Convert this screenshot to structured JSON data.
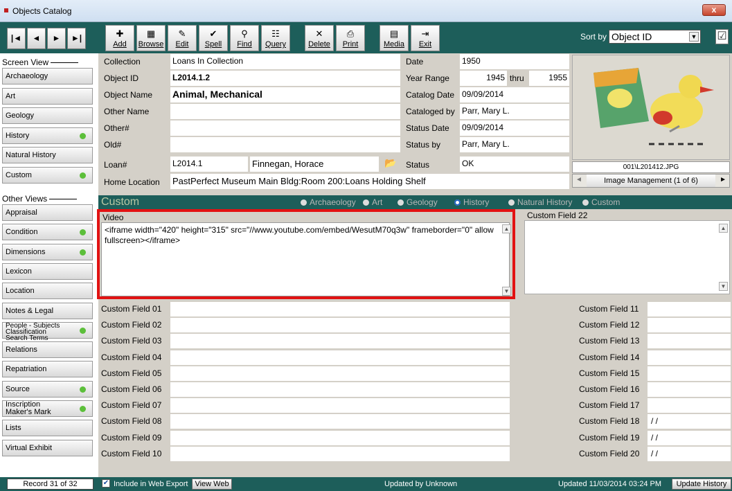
{
  "window": {
    "title": "Objects Catalog",
    "close_label": "x"
  },
  "toolbar": {
    "nav": [
      "|◄",
      "◄",
      "►",
      "►|"
    ],
    "buttons": [
      {
        "label": "Add",
        "glyph": "✚",
        "icon": "add-icon"
      },
      {
        "label": "Browse",
        "glyph": "▦",
        "icon": "browse-icon"
      },
      {
        "label": "Edit",
        "glyph": "✎",
        "icon": "edit-icon"
      },
      {
        "label": "Spell",
        "glyph": "✔",
        "icon": "spell-icon"
      },
      {
        "label": "Find",
        "glyph": "⚲",
        "icon": "find-icon"
      },
      {
        "label": "Query",
        "glyph": "☷",
        "icon": "query-icon"
      },
      {
        "label": "Delete",
        "glyph": "✕",
        "icon": "delete-icon"
      },
      {
        "label": "Print",
        "glyph": "⎙",
        "icon": "print-icon"
      },
      {
        "label": "Media",
        "glyph": "▤",
        "icon": "media-icon"
      },
      {
        "label": "Exit",
        "glyph": "⇥",
        "icon": "exit-icon"
      }
    ],
    "sort_label": "Sort by",
    "sort_value": "Object ID"
  },
  "sidebar": {
    "screen_view_label": "Screen View",
    "screen_views": [
      {
        "label": "Archaeology",
        "dot": false
      },
      {
        "label": "Art",
        "dot": false
      },
      {
        "label": "Geology",
        "dot": false
      },
      {
        "label": "History",
        "dot": true
      },
      {
        "label": "Natural History",
        "dot": false
      },
      {
        "label": "Custom",
        "dot": true
      }
    ],
    "other_views_label": "Other Views",
    "other_views": [
      {
        "label": "Appraisal",
        "dot": false
      },
      {
        "label": "Condition",
        "dot": true
      },
      {
        "label": "Dimensions",
        "dot": true
      },
      {
        "label": "Lexicon",
        "dot": false
      },
      {
        "label": "Location",
        "dot": false
      },
      {
        "label": "Notes & Legal",
        "dot": false
      },
      {
        "label": "People - Subjects\nClassification\nSearch Terms",
        "dot": true
      },
      {
        "label": "Relations",
        "dot": false
      },
      {
        "label": "Repatriation",
        "dot": false
      },
      {
        "label": "Source",
        "dot": true
      },
      {
        "label": "Inscription\nMaker's Mark",
        "dot": true
      },
      {
        "label": "Lists",
        "dot": false
      },
      {
        "label": "Virtual Exhibit",
        "dot": false
      }
    ]
  },
  "record": {
    "collection_label": "Collection",
    "collection": "Loans In Collection",
    "object_id_label": "Object ID",
    "object_id": "L2014.1.2",
    "object_name_label": "Object Name",
    "object_name": "Animal, Mechanical",
    "other_name_label": "Other Name",
    "other_name": "",
    "other_num_label": "Other#",
    "other_num": "",
    "old_num_label": "Old#",
    "old_num": "",
    "loan_label": "Loan#",
    "loan_num": "L2014.1",
    "loan_name": "Finnegan, Horace",
    "home_location_label": "Home Location",
    "home_location": "PastPerfect Museum Main Bldg:Room 200:Loans Holding Shelf",
    "date_label": "Date",
    "date": "1950",
    "year_range_label": "Year Range",
    "year_from": "1945",
    "thru_label": "thru",
    "year_to": "1955",
    "catalog_date_label": "Catalog Date",
    "catalog_date": "09/09/2014",
    "cataloged_by_label": "Cataloged by",
    "cataloged_by": "Parr, Mary L.",
    "status_date_label": "Status Date",
    "status_date": "09/09/2014",
    "status_by_label": "Status by",
    "status_by": "Parr, Mary L.",
    "status_label": "Status",
    "status": "OK"
  },
  "image": {
    "filename": "001\\L201412.JPG",
    "nav_label": "Image Management (1 of 6)"
  },
  "custom": {
    "title": "Custom",
    "radios": [
      {
        "label": "Archaeology",
        "on": false
      },
      {
        "label": "Art",
        "on": false
      },
      {
        "label": "Geology",
        "on": false
      },
      {
        "label": "History",
        "on": true
      },
      {
        "label": "Natural History",
        "on": false
      },
      {
        "label": "Custom",
        "on": false
      }
    ],
    "video_label": "Video",
    "video_value": "<iframe width=\"420\" height=\"315\" src=\"//www.youtube.com/embed/WesutM70q3w\" frameborder=\"0\" allowfullscreen></iframe>",
    "field22_label": "Custom Field 22",
    "left_fields": [
      {
        "label": "Custom Field 01"
      },
      {
        "label": "Custom Field 02"
      },
      {
        "label": "Custom Field 03"
      },
      {
        "label": "Custom Field 04"
      },
      {
        "label": "Custom Field 05"
      },
      {
        "label": "Custom Field 06"
      },
      {
        "label": "Custom Field 07"
      },
      {
        "label": "Custom Field 08"
      },
      {
        "label": "Custom Field 09"
      },
      {
        "label": "Custom Field 10"
      }
    ],
    "right_fields": [
      {
        "label": "Custom Field 11",
        "value": ""
      },
      {
        "label": "Custom Field 12",
        "value": ""
      },
      {
        "label": "Custom Field 13",
        "value": ""
      },
      {
        "label": "Custom Field 14",
        "value": ""
      },
      {
        "label": "Custom Field 15",
        "value": ""
      },
      {
        "label": "Custom Field 16",
        "value": ""
      },
      {
        "label": "Custom Field 17",
        "value": ""
      },
      {
        "label": "Custom Field 18",
        "value": "/ /"
      },
      {
        "label": "Custom Field 19",
        "value": "/ /"
      },
      {
        "label": "Custom Field 20",
        "value": "/ /"
      }
    ]
  },
  "status": {
    "record": "Record 31 of 32",
    "web_export": "Include in Web Export",
    "view_web": "View Web",
    "updated_by": "Updated by  Unknown",
    "updated": "Updated    11/03/2014 03:24 PM",
    "update_history": "Update History"
  }
}
